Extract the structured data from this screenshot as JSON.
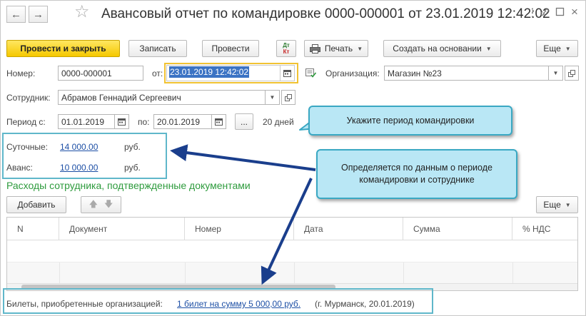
{
  "window": {
    "title": "Авансовый отчет по командировке 0000-000001 от 23.01.2019 12:42:02",
    "back_icon": "arrow-left-icon",
    "forward_icon": "arrow-right-icon",
    "favorite_icon": "star-icon",
    "menu_icon": "more-icon",
    "link_icon": "link-icon",
    "maximize_icon": "maximize-icon",
    "close_icon": "close-icon"
  },
  "toolbar": {
    "post_close_label": "Провести и закрыть",
    "save_label": "Записать",
    "post_label": "Провести",
    "dtkt_top": "Дт",
    "dtkt_bottom": "Кт",
    "print_label": "Печать",
    "create_based_label": "Создать на основании",
    "more_label": "Еще"
  },
  "form": {
    "number_label": "Номер:",
    "number_value": "0000-000001",
    "from_label": "от:",
    "date_value": "23.01.2019 12:42:02",
    "organization_label": "Организация:",
    "organization_value": "Магазин №23",
    "employee_label": "Сотрудник:",
    "employee_value": "Абрамов Геннадий Сергеевич",
    "period_from_label": "Период с:",
    "period_from_value": "01.01.2019",
    "period_to_label": "по:",
    "period_to_value": "20.01.2019",
    "period_select_label": "...",
    "days_label": "20 дней",
    "daily_label": "Суточные:",
    "daily_value": "14 000.00",
    "daily_currency": "руб.",
    "advance_label": "Аванс:",
    "advance_value": "10 000.00",
    "advance_currency": "руб."
  },
  "callouts": {
    "period": "Укажите период командировки",
    "determined": "Определяется по данным о периоде командировки и сотруднике"
  },
  "expenses": {
    "section_title": "Расходы сотрудника, подтвержденные документами",
    "add_label": "Добавить",
    "more_label": "Еще",
    "columns": [
      "N",
      "Документ",
      "Номер",
      "Дата",
      "Сумма",
      "% НДС"
    ]
  },
  "footer": {
    "tickets_label": "Билеты, приобретенные организацией:",
    "tickets_link": "1 билет на сумму 5 000,00 руб.",
    "tickets_note": "(г. Мурманск, 20.01.2019)"
  },
  "colors": {
    "primary_button": "#f5c800",
    "highlight": "#5fb7ca",
    "callout_fill": "#b9e7f5",
    "section_title": "#2e9b3d",
    "link": "#1d4fa5",
    "selection": "#3b73c4",
    "arrow": "#1a3e8c"
  }
}
